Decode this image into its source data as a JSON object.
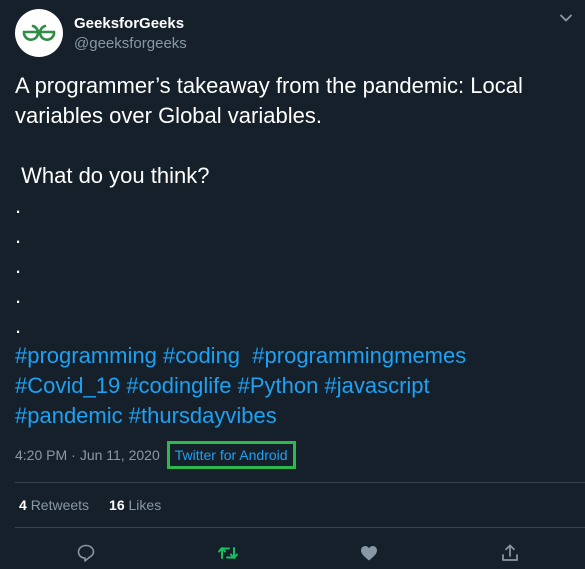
{
  "account": {
    "display_name": "GeeksforGeeks",
    "handle": "@geeksforgeeks",
    "avatar_logo": "GfG-logo"
  },
  "tweet": {
    "text_lines": [
      "A programmer’s takeaway from the pandemic: Local",
      "variables over Global variables.",
      " What do you think?",
      ".",
      ".",
      ".",
      ".",
      "."
    ],
    "hashtag_lines": [
      [
        "#programming",
        "#coding",
        "#programmingmemes"
      ],
      [
        "#Covid_19",
        "#codinglife",
        "#Python",
        "#javascript"
      ],
      [
        "#pandemic",
        "#thursdayvibes"
      ]
    ],
    "time": "4:20 PM",
    "separator": "·",
    "date": "Jun 11, 2020",
    "separator2": "·",
    "source": "Twitter for Android"
  },
  "stats": {
    "retweets_count": "4",
    "retweets_label": "Retweets",
    "likes_count": "16",
    "likes_label": "Likes"
  },
  "actions": {
    "reply_icon": "reply-icon",
    "retweet_icon": "retweet-icon",
    "like_icon": "heart-icon",
    "share_icon": "share-icon"
  },
  "colors": {
    "background": "#15202b",
    "text": "#ffffff",
    "secondary": "#8899a6",
    "link": "#1da1f2",
    "highlight_box": "#2db84d",
    "retweet_active": "#17bf63",
    "like_icon": "#8899a6",
    "divider": "#38444d"
  }
}
